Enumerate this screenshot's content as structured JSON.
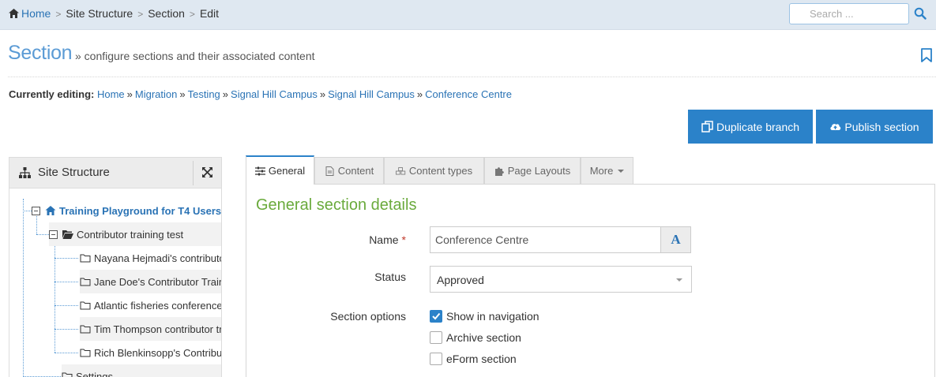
{
  "breadcrumb": {
    "items": [
      "Home",
      "Site Structure",
      "Section",
      "Edit"
    ],
    "separator": ">"
  },
  "search": {
    "placeholder": "Search ..."
  },
  "header": {
    "title": "Section",
    "subtitle": "» configure sections and their associated content"
  },
  "editing": {
    "label": "Currently editing:",
    "path": [
      "Home",
      "Migration",
      "Testing",
      "Signal Hill Campus",
      "Signal Hill Campus",
      "Conference Centre"
    ],
    "separator": "»"
  },
  "actions": {
    "duplicate_label": "Duplicate branch",
    "publish_label": "Publish section"
  },
  "site_structure": {
    "title": "Site Structure",
    "root": "Training Playground for T4 Users",
    "folder": "Contributor training test",
    "children": [
      "Nayana Hejmadi's contributor training",
      "Jane Doe's Contributor Training",
      "Atlantic fisheries conference",
      "Tim Thompson contributor training",
      "Rich Blenkinsopp's Contributor Training"
    ],
    "next": "Settings"
  },
  "tabs": [
    {
      "label": "General",
      "icon": "sliders-icon",
      "active": true
    },
    {
      "label": "Content",
      "icon": "document-icon",
      "active": false
    },
    {
      "label": "Content types",
      "icon": "cubes-icon",
      "active": false
    },
    {
      "label": "Page Layouts",
      "icon": "puzzle-icon",
      "active": false
    },
    {
      "label": "More",
      "icon": "caret-down-icon",
      "active": false
    }
  ],
  "form": {
    "heading": "General section details",
    "name_label": "Name",
    "required_mark": "*",
    "name_value": "Conference Centre",
    "font_button": "A",
    "status_label": "Status",
    "status_value": "Approved",
    "options_label": "Section options",
    "options": [
      {
        "label": "Show in navigation",
        "checked": true
      },
      {
        "label": "Archive section",
        "checked": false
      },
      {
        "label": "eForm section",
        "checked": false
      }
    ]
  },
  "colors": {
    "accent": "#2b82c9",
    "link": "#2a73b5",
    "heading_green": "#6aaa3c",
    "topbar": "#dfe8f1"
  }
}
